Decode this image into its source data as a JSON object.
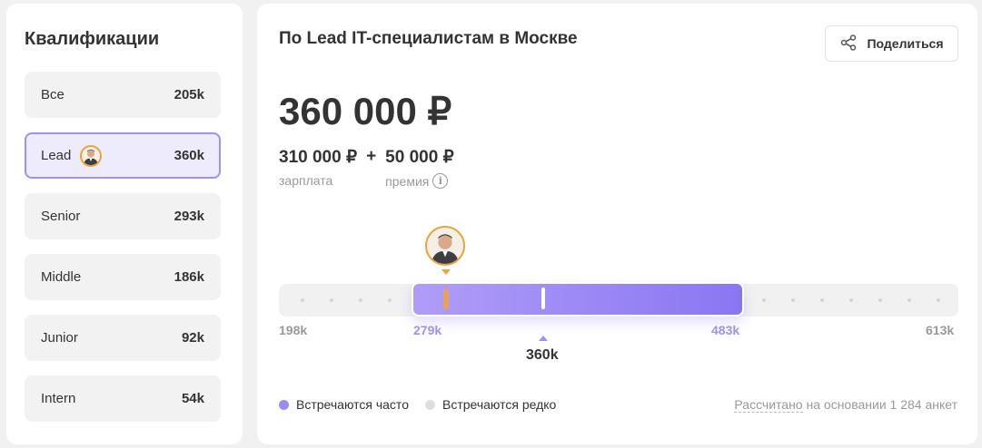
{
  "qualifications": {
    "title": "Квалификации",
    "items": [
      {
        "name": "Все",
        "value": "205k"
      },
      {
        "name": "Lead",
        "value": "360k"
      },
      {
        "name": "Senior",
        "value": "293k"
      },
      {
        "name": "Middle",
        "value": "186k"
      },
      {
        "name": "Junior",
        "value": "92k"
      },
      {
        "name": "Intern",
        "value": "54k"
      }
    ],
    "active": "Lead"
  },
  "main": {
    "title": "По Lead IT-специалистам в Москве",
    "share_label": "Поделиться",
    "total": "360 000 ₽",
    "salary_value": "310 000 ₽",
    "salary_label": "зарплата",
    "plus": "+",
    "bonus_value": "50 000 ₽",
    "bonus_label": "премия"
  },
  "range": {
    "min_label": "198k",
    "low_label": "279k",
    "high_label": "483k",
    "max_label": "613k",
    "median_label": "360k"
  },
  "legend": {
    "frequent": "Встречаются часто",
    "rare": "Встречаются редко",
    "footnote_prefix": "Рассчитано",
    "footnote_rest": " на основании 1 284 анкет"
  },
  "colors": {
    "accent": "#8a76f2",
    "avatar_border": "#e8a43a",
    "rare_dot": "#dddddd"
  },
  "icons": [
    "avatar-icon",
    "share-icon",
    "info-icon"
  ]
}
